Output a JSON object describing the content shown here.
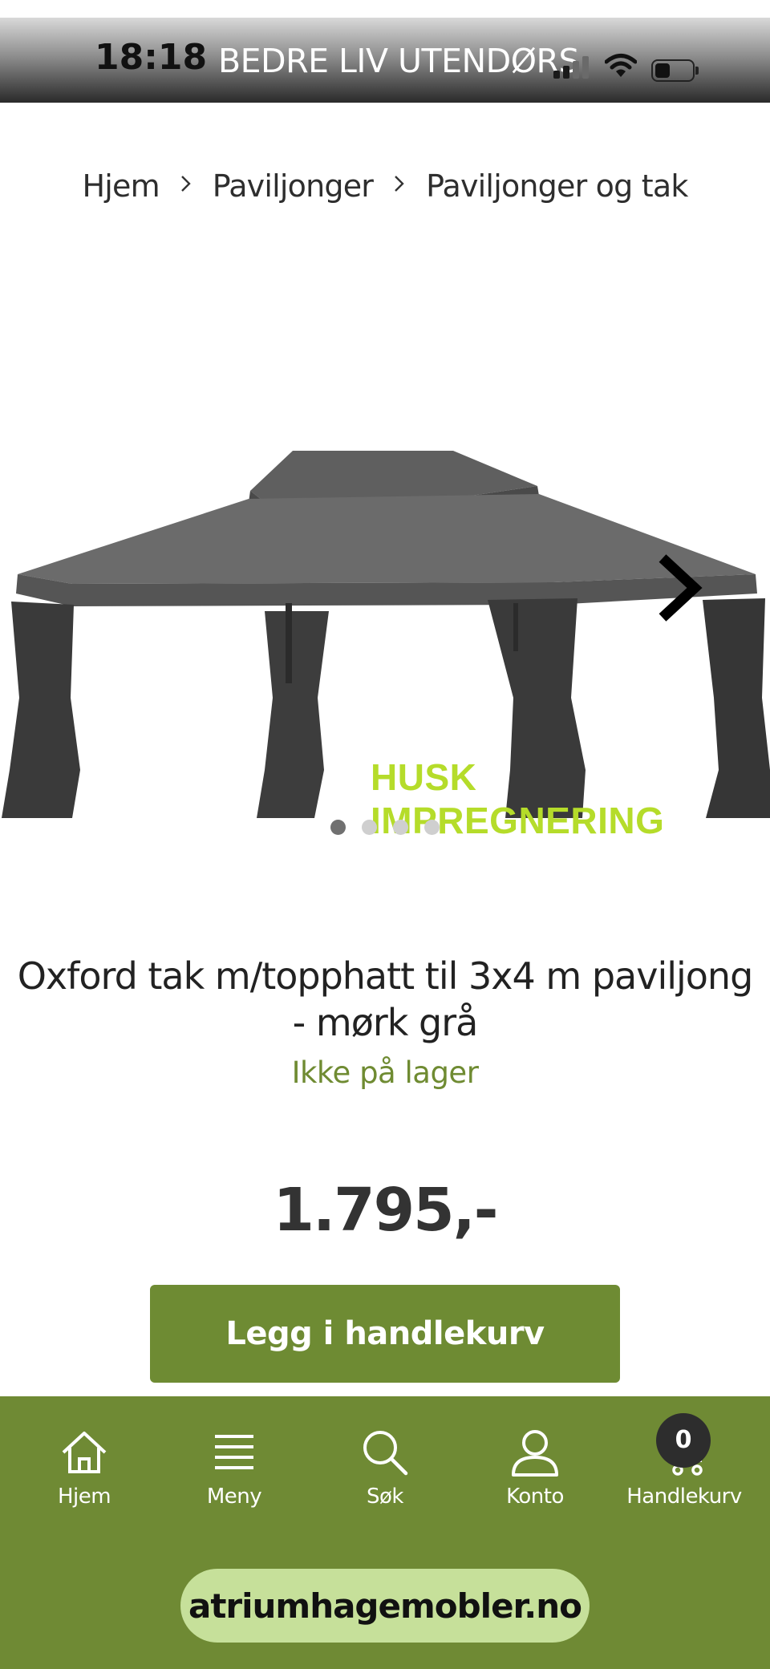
{
  "status_bar": {
    "time": "18:18",
    "title": "BEDRE LIV UTENDØRS",
    "icons": [
      "cellular-signal-icon",
      "wifi-icon",
      "battery-icon"
    ]
  },
  "breadcrumb": {
    "items": [
      "Hjem",
      "Paviljonger",
      "Paviljonger og tak"
    ],
    "separator_icon": "chevron-right-icon"
  },
  "product": {
    "image_overlay_text": "HUSK IMPREGNERING",
    "carousel": {
      "count": 4,
      "active_index": 0,
      "next_icon": "chevron-right-icon"
    },
    "title": "Oxford tak m/topphatt til 3x4 m paviljong - mørk grå",
    "stock_status": "Ikke på lager",
    "price": "1.795,-",
    "add_to_cart_label": "Legg i handlekurv"
  },
  "bottom_nav": {
    "items": [
      {
        "label": "Hjem",
        "icon": "home-icon"
      },
      {
        "label": "Meny",
        "icon": "menu-icon"
      },
      {
        "label": "Søk",
        "icon": "search-icon"
      },
      {
        "label": "Konto",
        "icon": "user-icon"
      },
      {
        "label": "Handlekurv",
        "icon": "cart-icon"
      }
    ],
    "cart_count": "0"
  },
  "browser": {
    "url": "atriumhagemobler.no"
  },
  "colors": {
    "brand_green": "#6f8a34",
    "stock_green": "#6f8b32",
    "promo_lime": "#b5dc2a",
    "url_pill": "#c6e09a"
  }
}
